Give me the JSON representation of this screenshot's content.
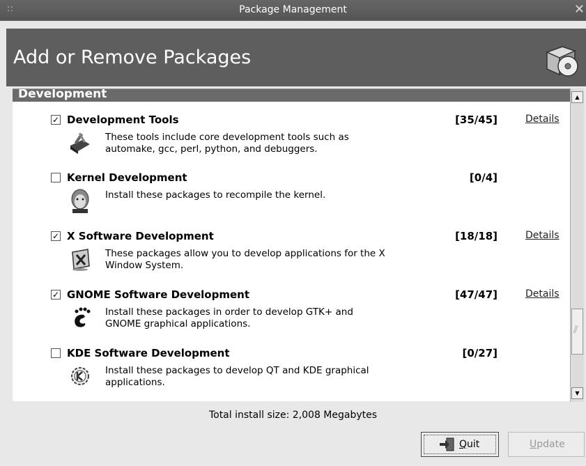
{
  "window": {
    "title": "Package Management",
    "close_glyph": "✕",
    "grip_glyph": "::"
  },
  "banner": {
    "heading": "Add or Remove Packages",
    "icon": "package-cd-icon"
  },
  "category": {
    "name": "Development"
  },
  "packages": [
    {
      "name": "Development Tools",
      "checked": true,
      "count": "[35/45]",
      "details": "Details",
      "desc_line1": "These tools include core development tools such as",
      "desc_line2": "automake, gcc, perl, python, and debuggers.",
      "icon": "tools-icon"
    },
    {
      "name": "Kernel Development",
      "checked": false,
      "count": "[0/4]",
      "details": "",
      "desc_line1": "Install these packages to recompile the kernel.",
      "desc_line2": "",
      "icon": "tux-face-icon"
    },
    {
      "name": "X Software Development",
      "checked": true,
      "count": "[18/18]",
      "details": "Details",
      "desc_line1": "These packages allow you to develop applications for the X",
      "desc_line2": "Window System.",
      "icon": "x-window-icon"
    },
    {
      "name": "GNOME Software Development",
      "checked": true,
      "count": "[47/47]",
      "details": "Details",
      "desc_line1": "Install these packages in order to develop GTK+ and",
      "desc_line2": "GNOME graphical applications.",
      "icon": "gnome-foot-icon"
    },
    {
      "name": "KDE Software Development",
      "checked": false,
      "count": "[0/27]",
      "details": "",
      "desc_line1": "Install these packages to develop QT and KDE graphical",
      "desc_line2": "applications.",
      "icon": "kde-gear-icon"
    }
  ],
  "footer": {
    "total": "Total install size: 2,008 Megabytes"
  },
  "buttons": {
    "quit": {
      "mnemonic": "Q",
      "rest": "uit"
    },
    "update": {
      "mnemonic": "U",
      "rest": "pdate",
      "disabled": true
    }
  },
  "check_glyph": "✓"
}
